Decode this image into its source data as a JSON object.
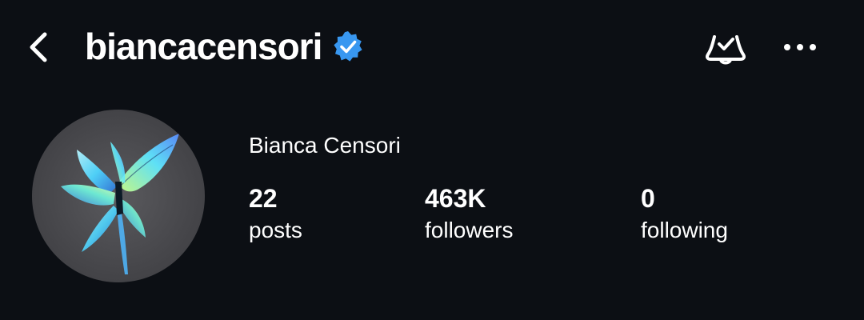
{
  "header": {
    "username": "biancacensori",
    "verified": true,
    "back_icon": "chevron-left-icon",
    "verified_icon": "verified-badge-icon",
    "notification_icon": "bell-check-icon",
    "more_icon": "more-horizontal-icon"
  },
  "profile": {
    "display_name": "Bianca Censori",
    "avatar_icon": "butterfly-avatar-image"
  },
  "stats": {
    "posts": {
      "value": "22",
      "label": "posts"
    },
    "followers": {
      "value": "463K",
      "label": "followers"
    },
    "following": {
      "value": "0",
      "label": "following"
    }
  },
  "colors": {
    "background": "#0c0f14",
    "text": "#ffffff",
    "verified_blue": "#3897f0",
    "avatar_bg": "#4a4a4e",
    "avatar_wing": "#6fe0ff"
  }
}
